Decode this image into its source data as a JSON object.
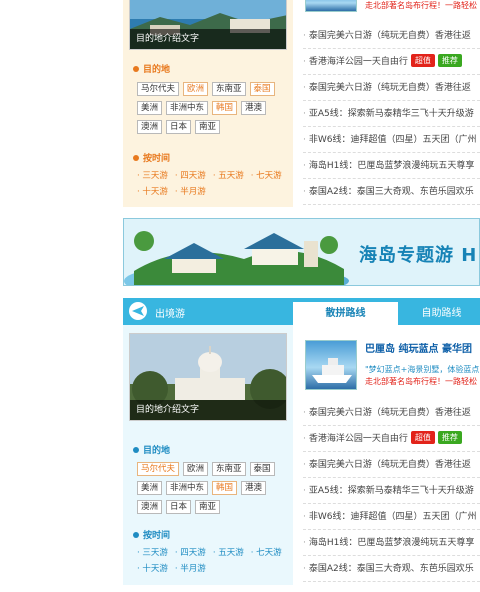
{
  "section1": {
    "photo_caption": "目的地介绍文字",
    "promo_tail": "走北部著名岛布行程！一路轻松",
    "dest_heading": "目的地",
    "dest_tags": [
      {
        "label": "马尔代夫",
        "hot": false
      },
      {
        "label": "欧洲",
        "hot": true
      },
      {
        "label": "东南亚",
        "hot": false
      },
      {
        "label": "泰国",
        "hot": true
      },
      {
        "label": "美洲",
        "hot": false
      },
      {
        "label": "非洲中东",
        "hot": false
      },
      {
        "label": "韩国",
        "hot": true
      },
      {
        "label": "港澳",
        "hot": false
      },
      {
        "label": "澳洲",
        "hot": false
      },
      {
        "label": "日本",
        "hot": false
      },
      {
        "label": "南亚",
        "hot": false
      }
    ],
    "days_heading": "按时间",
    "days": [
      "三天游",
      "四天游",
      "五天游",
      "七天游",
      "十天游",
      "半月游"
    ],
    "lines": [
      {
        "text": "泰国完美六日游（纯玩无自费）香港往返",
        "badges": []
      },
      {
        "text": "香港海洋公园一天自由行",
        "badges": [
          {
            "label": "超值",
            "color": "red"
          },
          {
            "label": "推荐",
            "color": "green"
          }
        ]
      },
      {
        "text": "泰国完美六日游（纯玩无自费）香港往返",
        "badges": []
      },
      {
        "text": "亚A5线：探索新马泰精华三飞十天升级游",
        "badges": []
      },
      {
        "text": "非W6线：迪拜超值（四星）五天团（广州",
        "badges": []
      },
      {
        "text": "海岛H1线：巴厘岛蓝梦浪漫纯玩五天尊享",
        "badges": []
      },
      {
        "text": "泰国A2线：泰国三大奇观、东芭乐园欢乐",
        "badges": []
      }
    ]
  },
  "banner": {
    "text": "海岛专题游 H"
  },
  "section2": {
    "title": "出境游",
    "tabs": [
      "散拼路线",
      "自助路线"
    ],
    "photo_caption": "目的地介绍文字",
    "promo": {
      "title": "巴厘岛  纯玩蓝点  豪华团",
      "desc1": "\"梦幻蓝点+海景别墅，体验蓝点",
      "desc2": "走北部著名岛布行程！一路轻松"
    },
    "dest_heading": "目的地",
    "dest_tags": [
      {
        "label": "马尔代夫",
        "hot": true
      },
      {
        "label": "欧洲",
        "hot": false
      },
      {
        "label": "东南亚",
        "hot": false
      },
      {
        "label": "泰国",
        "hot": false
      },
      {
        "label": "美洲",
        "hot": false
      },
      {
        "label": "非洲中东",
        "hot": false
      },
      {
        "label": "韩国",
        "hot": true
      },
      {
        "label": "港澳",
        "hot": false
      },
      {
        "label": "澳洲",
        "hot": false
      },
      {
        "label": "日本",
        "hot": false
      },
      {
        "label": "南亚",
        "hot": false
      }
    ],
    "days_heading": "按时间",
    "days": [
      "三天游",
      "四天游",
      "五天游",
      "七天游",
      "十天游",
      "半月游"
    ],
    "lines": [
      {
        "text": "泰国完美六日游（纯玩无自费）香港往返",
        "badges": []
      },
      {
        "text": "香港海洋公园一天自由行",
        "badges": [
          {
            "label": "超值",
            "color": "red"
          },
          {
            "label": "推荐",
            "color": "green"
          }
        ]
      },
      {
        "text": "泰国完美六日游（纯玩无自费）香港往返",
        "badges": []
      },
      {
        "text": "亚A5线：探索新马泰精华三飞十天升级游",
        "badges": []
      },
      {
        "text": "非W6线：迪拜超值（四星）五天团（广州",
        "badges": []
      },
      {
        "text": "海岛H1线：巴厘岛蓝梦浪漫纯玩五天尊享",
        "badges": []
      },
      {
        "text": "泰国A2线：泰国三大奇观、东芭乐园欢乐",
        "badges": []
      }
    ]
  }
}
